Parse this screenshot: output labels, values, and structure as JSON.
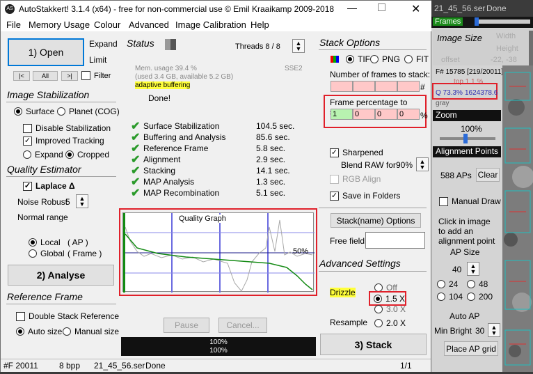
{
  "window": {
    "title": "AutoStakkert! 3.1.4 (x64) - free for non-commercial use © Emil Kraaikamp 2009-2018"
  },
  "menu": [
    "File",
    "Memory Usage",
    "Colour",
    "Advanced",
    "Image Calibration",
    "Help"
  ],
  "left": {
    "open_label": "1) Open",
    "expand": "Expand",
    "limit": "Limit",
    "nav": [
      "|<",
      "All",
      ">|"
    ],
    "filter": "Filter",
    "stab_title": "Image Stabilization",
    "surface": "Surface",
    "planet": "Planet (COG)",
    "disable_stab": "Disable Stabilization",
    "improved_tracking": "Improved Tracking",
    "expand2": "Expand",
    "cropped": "Cropped",
    "quality_title": "Quality Estimator",
    "laplace": "Laplace Δ",
    "noise_label": "Noise Robust",
    "noise_val": "5",
    "normal_range": "Normal range",
    "local": "Local",
    "local_ap": "( AP )",
    "global": "Global",
    "global_frame": "( Frame )",
    "analyse_label": "2) Analyse",
    "ref_title": "Reference Frame",
    "double_stack": "Double Stack Reference",
    "auto_size": "Auto size",
    "manual_size": "Manual size"
  },
  "status": {
    "title": "Status",
    "threads": "Threads 8 / 8",
    "mem1": "Mem. usage 39.4 %",
    "mem2": "(used 3.4 GB, available 5.2 GB)",
    "sse": "SSE2",
    "adaptive": "adaptive buffering",
    "done": "Done!",
    "steps": [
      {
        "name": "Surface Stabilization",
        "time": "104.5 sec."
      },
      {
        "name": "Buffering and Analysis",
        "time": "85.6 sec."
      },
      {
        "name": "Reference Frame",
        "time": "5.8 sec."
      },
      {
        "name": "Alignment",
        "time": "2.9 sec."
      },
      {
        "name": "Stacking",
        "time": "14.1 sec."
      },
      {
        "name": "MAP Analysis",
        "time": "1.3 sec."
      },
      {
        "name": "MAP Recombination",
        "time": "5.1 sec."
      }
    ],
    "graph_title": "Quality Graph",
    "graph_pct": "50%",
    "pause": "Pause",
    "cancel": "Cancel...",
    "progress1": "100%",
    "progress2": "100%"
  },
  "stack": {
    "title": "Stack Options",
    "tif": "TIF",
    "png": "PNG",
    "fit": "FIT",
    "frames_label": "Number of frames to stack:",
    "hash": "#",
    "pct_label": "Frame percentage to stack:",
    "pct_values": [
      "1",
      "0",
      "0",
      "0"
    ],
    "pct_sign": "%",
    "sharpened": "Sharpened",
    "blend_raw": "Blend RAW for",
    "blend_val": "90%",
    "rgb_align": "RGB Align",
    "save_folders": "Save in Folders",
    "stackname_btn": "Stack(name) Options",
    "free_field": "Free field",
    "adv_title": "Advanced Settings",
    "drizzle": "Drizzle",
    "drizzle_off": "Off",
    "drizzle_15": "1.5 X",
    "drizzle_30": "3.0 X",
    "resample": "Resample",
    "resample_20": "2.0 X",
    "stack_btn": "3) Stack"
  },
  "statusbar": {
    "frames": "#F 20011",
    "bpp": "8 bpp",
    "file": "21_45_56.ser",
    "state": "Done",
    "page": "1/1"
  },
  "side": {
    "title": "21_45_56.ser",
    "state": "Done",
    "frames_tab": "Frames",
    "image_size": "Image Size",
    "width": "Width",
    "height": "Height",
    "offset_label": "offset",
    "offset": "-22, -38",
    "frame_info": "F# 15785 [219/20011]",
    "top": "top 1.1 %",
    "quality": "Q 73.3%",
    "qvalue": "1624378.6",
    "gray": "gray",
    "zoom": "Zoom",
    "zoom_val": "100%",
    "ap_title": "Alignment Points",
    "ap_count": "588 APs",
    "clear": "Clear",
    "manual_draw": "Manual Draw",
    "click_text": "Click in image to add an alignment point",
    "ap_size": "AP Size",
    "ap_size_val": "40",
    "sizes": [
      "24",
      "48",
      "104",
      "200"
    ],
    "auto_ap": "Auto AP",
    "min_bright": "Min Bright",
    "min_bright_val": "30",
    "place_grid": "Place AP grid"
  },
  "colors": {
    "accent": "#e0202a",
    "progress": "#111111",
    "curve": "#138a13"
  }
}
